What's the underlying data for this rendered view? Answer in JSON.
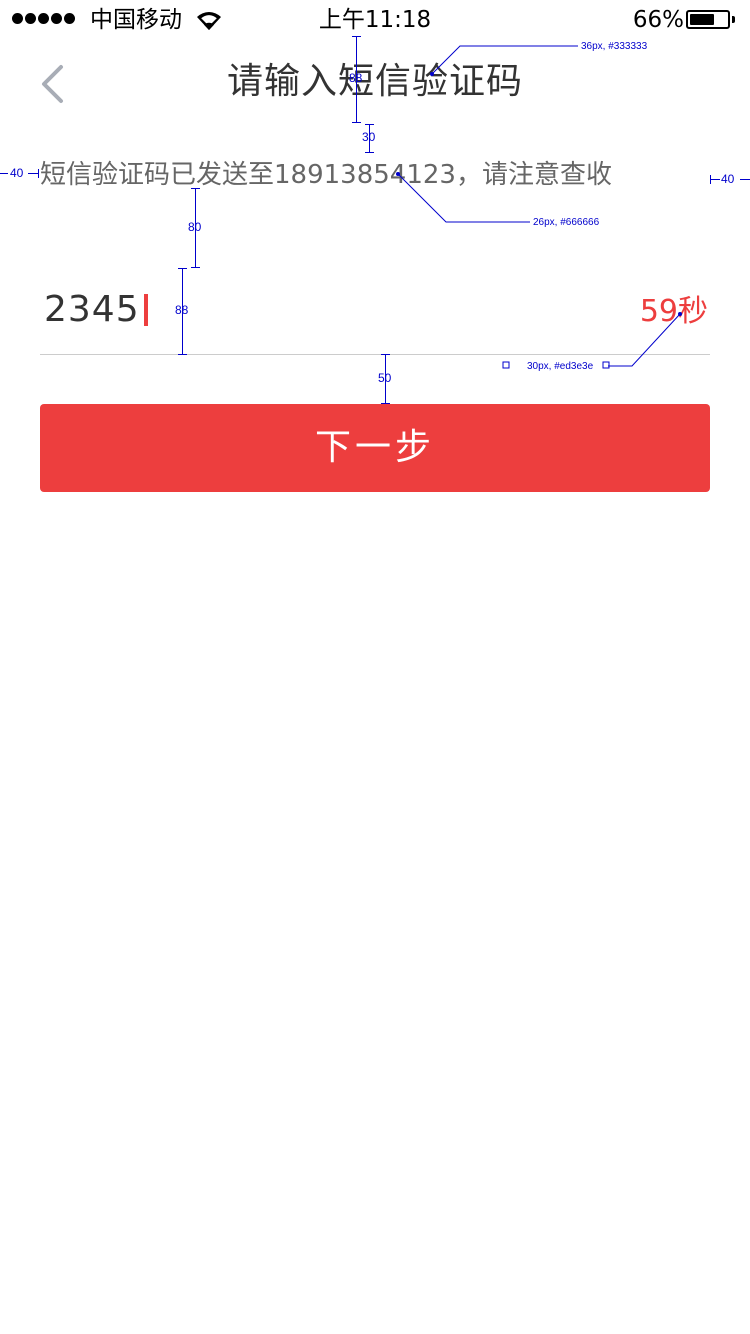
{
  "status_bar": {
    "signal_dots": 5,
    "carrier": "中国移动",
    "time": "上午11:18",
    "battery_percent_text": "66%",
    "battery_level": 0.66
  },
  "nav": {
    "back_icon": "chevron-left-icon",
    "title": "请输入短信验证码"
  },
  "hint": {
    "text": "短信验证码已发送至18913854123，请注意查收"
  },
  "code_field": {
    "value": "2345",
    "countdown": "59秒"
  },
  "next_button": {
    "label": "下一步"
  },
  "colors": {
    "accent": "#ed3e3e",
    "title_text": "#333333",
    "hint_text": "#666666",
    "divider": "#cccccc",
    "annotation": "#0000cc"
  },
  "annotations": {
    "title_spec": "36px, #333333",
    "hint_spec": "26px, #666666",
    "countdown_spec": "30px, #ed3e3e",
    "nav_height": "88",
    "nav_to_hint_gap": "30",
    "hint_to_field_gap": "80",
    "field_height": "88",
    "field_to_button_gap": "50",
    "side_margin_left": "40",
    "side_margin_right": "40"
  }
}
